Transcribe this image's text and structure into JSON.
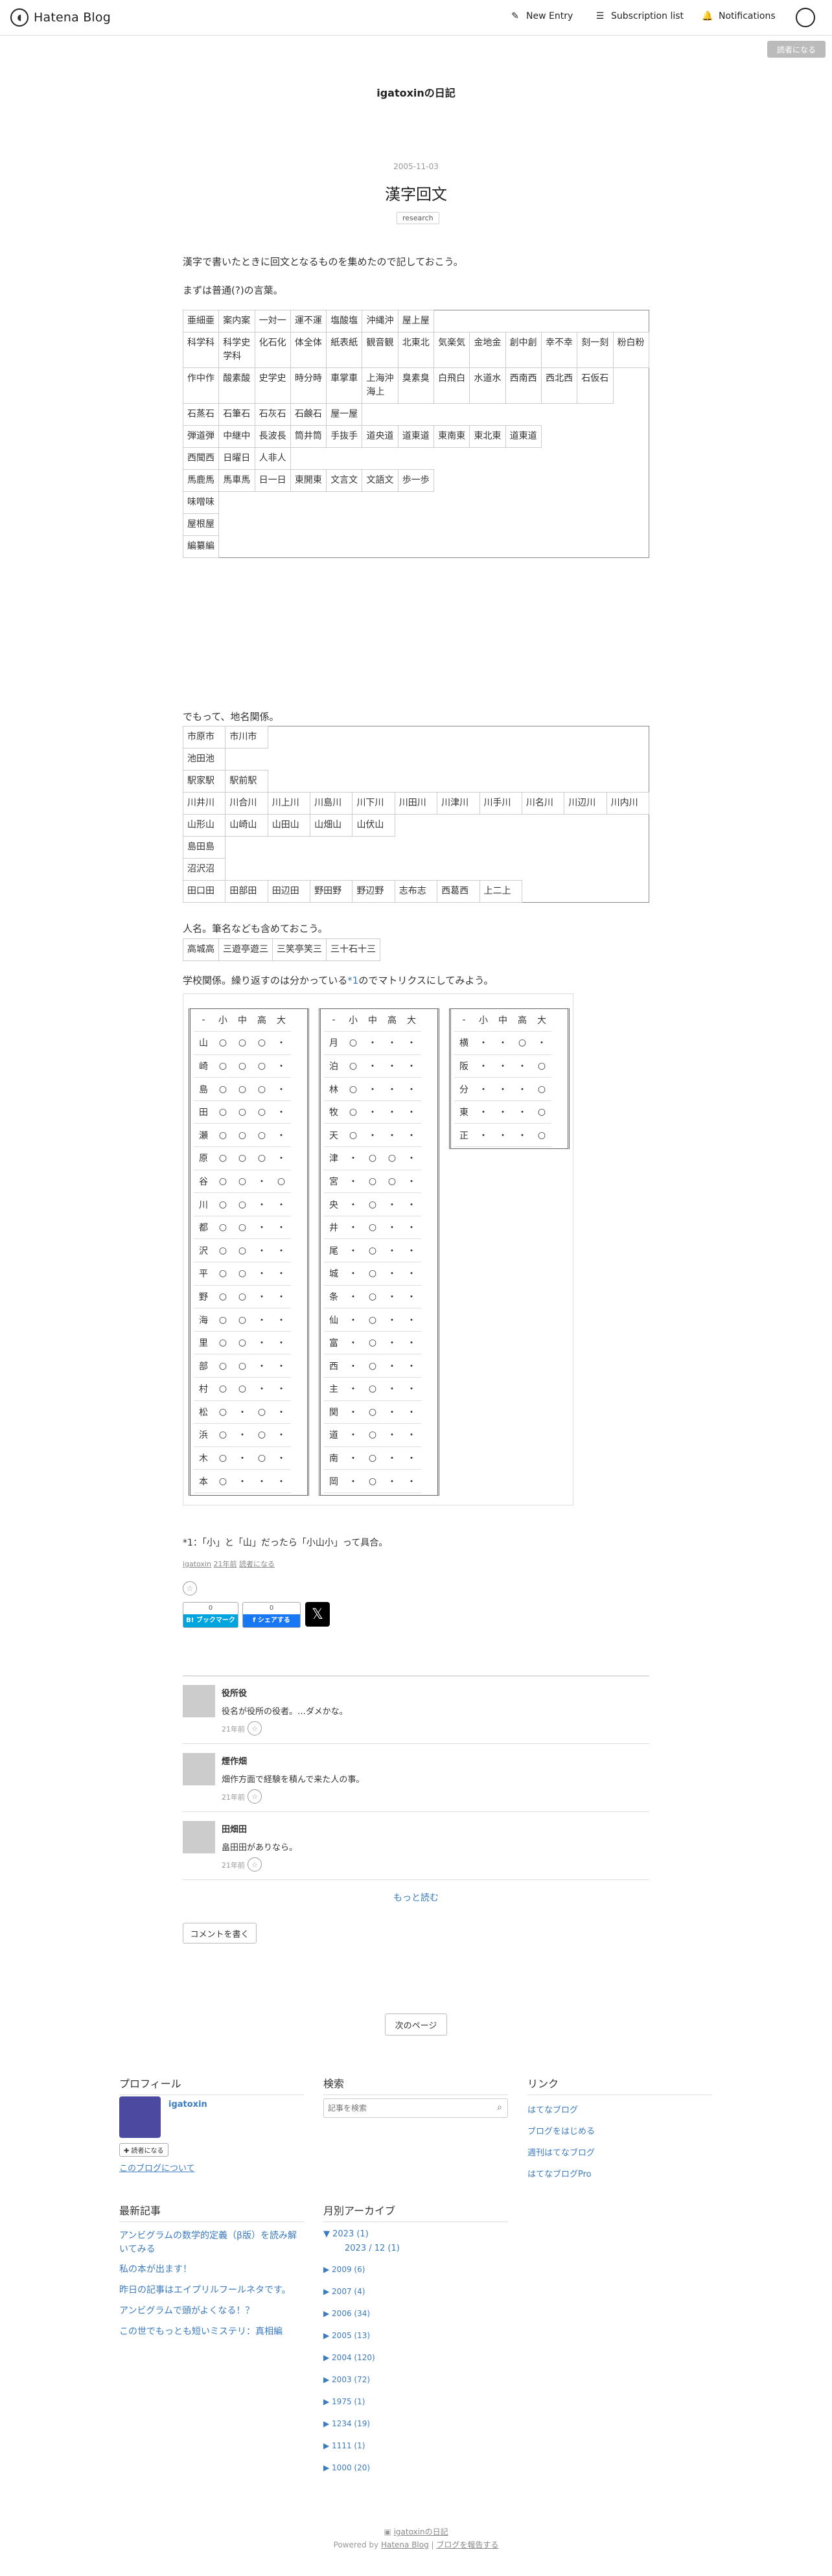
{
  "header": {
    "brand": "Hatena Blog",
    "new_entry": "New Entry",
    "subscription": "Subscription list",
    "notifications": "Notifications",
    "subscribe_top": "読者になる"
  },
  "blog": {
    "title": "igatoxinの日記"
  },
  "entry": {
    "date": "2005-11-03",
    "title": "漢字回文",
    "category": "research",
    "p1": "漢字で書いたときに回文となるものを集めたので記しておこう。",
    "p2": "まずは普通(?)の言葉。",
    "t1": [
      [
        "亜細亜",
        "案内案",
        "一対一",
        "運不運",
        "塩酸塩",
        "沖縄沖",
        "屋上屋"
      ],
      [
        "科学科",
        "科学史学科",
        "化石化",
        "体全体",
        "紙表紙",
        "観音観",
        "北東北",
        "気楽気",
        "金地金",
        "創中創",
        "幸不幸",
        "刻一刻",
        "粉白粉"
      ],
      [
        "作中作",
        "酸素酸",
        "史学史",
        "時分時",
        "車掌車",
        "上海沖海上",
        "臭素臭",
        "白飛白",
        "水道水",
        "西南西",
        "西北西",
        "石仮石"
      ],
      [
        "石蒸石",
        "石筆石",
        "石灰石",
        "石鹸石",
        "屋一屋"
      ],
      [
        "弾道弾",
        "中継中",
        "長波長",
        "筒井筒",
        "手抜手",
        "道央道",
        "道東道",
        "東南東",
        "東北東",
        "道東道"
      ],
      [
        "西聞西",
        "日曜日",
        "人非人"
      ],
      [
        "馬鹿馬",
        "馬車馬",
        "日一日",
        "東開東",
        "文言文",
        "文語文",
        "歩一歩"
      ],
      [
        "味噌味"
      ],
      [
        "屋根屋"
      ],
      [
        "編纂編"
      ]
    ],
    "p3": "でもって、地名関係。",
    "t2": [
      [
        "市原市",
        "市川市"
      ],
      [
        "池田池"
      ],
      [
        "駅家駅",
        "駅前駅"
      ],
      [
        "川井川",
        "川合川",
        "川上川",
        "川島川",
        "川下川",
        "川田川",
        "川津川",
        "川手川",
        "川名川",
        "川辺川",
        "川内川"
      ],
      [
        "山形山",
        "山崎山",
        "山田山",
        "山畑山",
        "山伏山"
      ],
      [
        "島田島"
      ],
      [
        "沼沢沼"
      ],
      [
        "田口田",
        "田部田",
        "田辺田",
        "野田野",
        "野辺野",
        "志布志",
        "西葛西",
        "上二上"
      ]
    ],
    "p4": "人名。筆名なども含めておこう。",
    "t3": [
      [
        "高城高",
        "三遊亭遊三",
        "三笑亭笑三",
        "三十石十三"
      ]
    ],
    "p5": "学校関係。繰り返すのは分かっている",
    "p5_fn": "*1",
    "p5_tail": "のでマトリクスにしてみよう。",
    "matrix_header": [
      "-",
      "小",
      "中",
      "高",
      "大"
    ],
    "m1": [
      [
        "山",
        "○",
        "○",
        "○",
        "・"
      ],
      [
        "崎",
        "○",
        "○",
        "○",
        "・"
      ],
      [
        "島",
        "○",
        "○",
        "○",
        "・"
      ],
      [
        "田",
        "○",
        "○",
        "○",
        "・"
      ],
      [
        "瀬",
        "○",
        "○",
        "○",
        "・"
      ],
      [
        "原",
        "○",
        "○",
        "○",
        "・"
      ],
      [
        "谷",
        "○",
        "○",
        "・",
        "○"
      ],
      [
        "川",
        "○",
        "○",
        "・",
        "・"
      ],
      [
        "都",
        "○",
        "○",
        "・",
        "・"
      ],
      [
        "沢",
        "○",
        "○",
        "・",
        "・"
      ],
      [
        "平",
        "○",
        "○",
        "・",
        "・"
      ],
      [
        "野",
        "○",
        "○",
        "・",
        "・"
      ],
      [
        "海",
        "○",
        "○",
        "・",
        "・"
      ],
      [
        "里",
        "○",
        "○",
        "・",
        "・"
      ],
      [
        "部",
        "○",
        "○",
        "・",
        "・"
      ],
      [
        "村",
        "○",
        "○",
        "・",
        "・"
      ],
      [
        "松",
        "○",
        "・",
        "○",
        "・"
      ],
      [
        "浜",
        "○",
        "・",
        "○",
        "・"
      ],
      [
        "木",
        "○",
        "・",
        "○",
        "・"
      ],
      [
        "本",
        "○",
        "・",
        "・",
        "・"
      ]
    ],
    "m2": [
      [
        "月",
        "○",
        "・",
        "・",
        "・"
      ],
      [
        "泊",
        "○",
        "・",
        "・",
        "・"
      ],
      [
        "林",
        "○",
        "・",
        "・",
        "・"
      ],
      [
        "牧",
        "○",
        "・",
        "・",
        "・"
      ],
      [
        "天",
        "○",
        "・",
        "・",
        "・"
      ],
      [
        "津",
        "・",
        "○",
        "○",
        "・"
      ],
      [
        "宮",
        "・",
        "○",
        "○",
        "・"
      ],
      [
        "央",
        "・",
        "○",
        "・",
        "・"
      ],
      [
        "井",
        "・",
        "○",
        "・",
        "・"
      ],
      [
        "尾",
        "・",
        "○",
        "・",
        "・"
      ],
      [
        "城",
        "・",
        "○",
        "・",
        "・"
      ],
      [
        "条",
        "・",
        "○",
        "・",
        "・"
      ],
      [
        "仙",
        "・",
        "○",
        "・",
        "・"
      ],
      [
        "富",
        "・",
        "○",
        "・",
        "・"
      ],
      [
        "西",
        "・",
        "○",
        "・",
        "・"
      ],
      [
        "主",
        "・",
        "○",
        "・",
        "・"
      ],
      [
        "関",
        "・",
        "○",
        "・",
        "・"
      ],
      [
        "道",
        "・",
        "○",
        "・",
        "・"
      ],
      [
        "南",
        "・",
        "○",
        "・",
        "・"
      ],
      [
        "岡",
        "・",
        "○",
        "・",
        "・"
      ]
    ],
    "m3": [
      [
        "横",
        "・",
        "・",
        "○",
        "・"
      ],
      [
        "阪",
        "・",
        "・",
        "・",
        "○"
      ],
      [
        "分",
        "・",
        "・",
        "・",
        "○"
      ],
      [
        "東",
        "・",
        "・",
        "・",
        "○"
      ],
      [
        "正",
        "・",
        "・",
        "・",
        "○"
      ]
    ],
    "footnote": "*1：「小」と「山」だったら「小山小」って具合。",
    "meta_author": "igatoxin",
    "meta_time": "21年前",
    "meta_subscribe": "読者になる"
  },
  "share": {
    "hatena_count": "0",
    "hatena_label": "B! ブックマーク",
    "fb_count": "0",
    "fb_label": "f シェアする",
    "x_label": "𝕏"
  },
  "comments": [
    {
      "name": "役所役",
      "text": "役名が役所の役者。…ダメかな。",
      "time": "21年前"
    },
    {
      "name": "煙作畑",
      "text": "畑作方面で経験を積んで来た人の事。",
      "time": "21年前"
    },
    {
      "name": "田畑田",
      "text": "畠田田がありなら。",
      "time": "21年前"
    }
  ],
  "more": "もっと読む",
  "write_comment": "コメントを書く",
  "next_page": "次のページ",
  "sidebar": {
    "profile_h": "プロフィール",
    "profile_name": "igatoxin",
    "profile_subscribe": "✚ 読者になる",
    "profile_about": "このブログについて",
    "search_h": "検索",
    "search_placeholder": "記事を検索",
    "links_h": "リンク",
    "links": [
      "はてなブログ",
      "ブログをはじめる",
      "週刊はてなブログ",
      "はてなブログPro"
    ],
    "recent_h": "最新記事",
    "recent": [
      "アンビグラムの数学的定義（β版）を読み解いてみる",
      "私の本が出ます！",
      "昨日の記事はエイプリルフールネタです。",
      "アンビグラムで頭がよくなる！？",
      "この世でもっとも短いミステリ：真相編"
    ],
    "archive_h": "月別アーカイブ",
    "archive_open": "▼ 2023 (1)",
    "archive_sub": "2023 / 12 (1)",
    "archive": [
      "▶ 2009 (6)",
      "▶ 2007 (4)",
      "▶ 2006 (34)",
      "▶ 2005 (13)",
      "▶ 2004 (120)",
      "▶ 2003 (72)",
      "▶ 1975 (1)",
      "▶ 1234 (19)",
      "▶ 1111 (1)",
      "▶ 1000 (20)"
    ]
  },
  "footer": {
    "blog": "igatoxinの日記",
    "powered": "Powered by ",
    "hatena": "Hatena Blog",
    "sep": " | ",
    "report": "ブログを報告する"
  }
}
